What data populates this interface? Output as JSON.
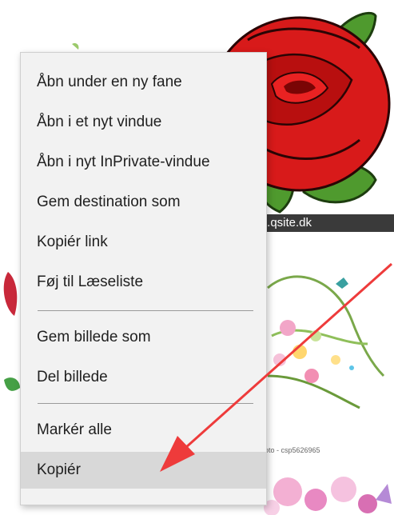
{
  "watermark_text": "t.qsite.dk",
  "photo_credit": "hoto - csp5626965",
  "context_menu": {
    "items": [
      {
        "label": "Åbn under en ny fane"
      },
      {
        "label": "Åbn i et nyt vindue"
      },
      {
        "label": "Åbn i nyt InPrivate-vindue"
      },
      {
        "label": "Gem destination som"
      },
      {
        "label": "Kopiér link"
      },
      {
        "label": "Føj til Læseliste"
      },
      {
        "label": "Gem billede som"
      },
      {
        "label": "Del billede"
      },
      {
        "label": "Markér alle"
      },
      {
        "label": "Kopiér",
        "selected": true
      }
    ]
  },
  "colors": {
    "annotation_arrow": "#ee3b3b",
    "menu_background": "#f2f2f2",
    "selected_item": "#d8d8d8"
  }
}
